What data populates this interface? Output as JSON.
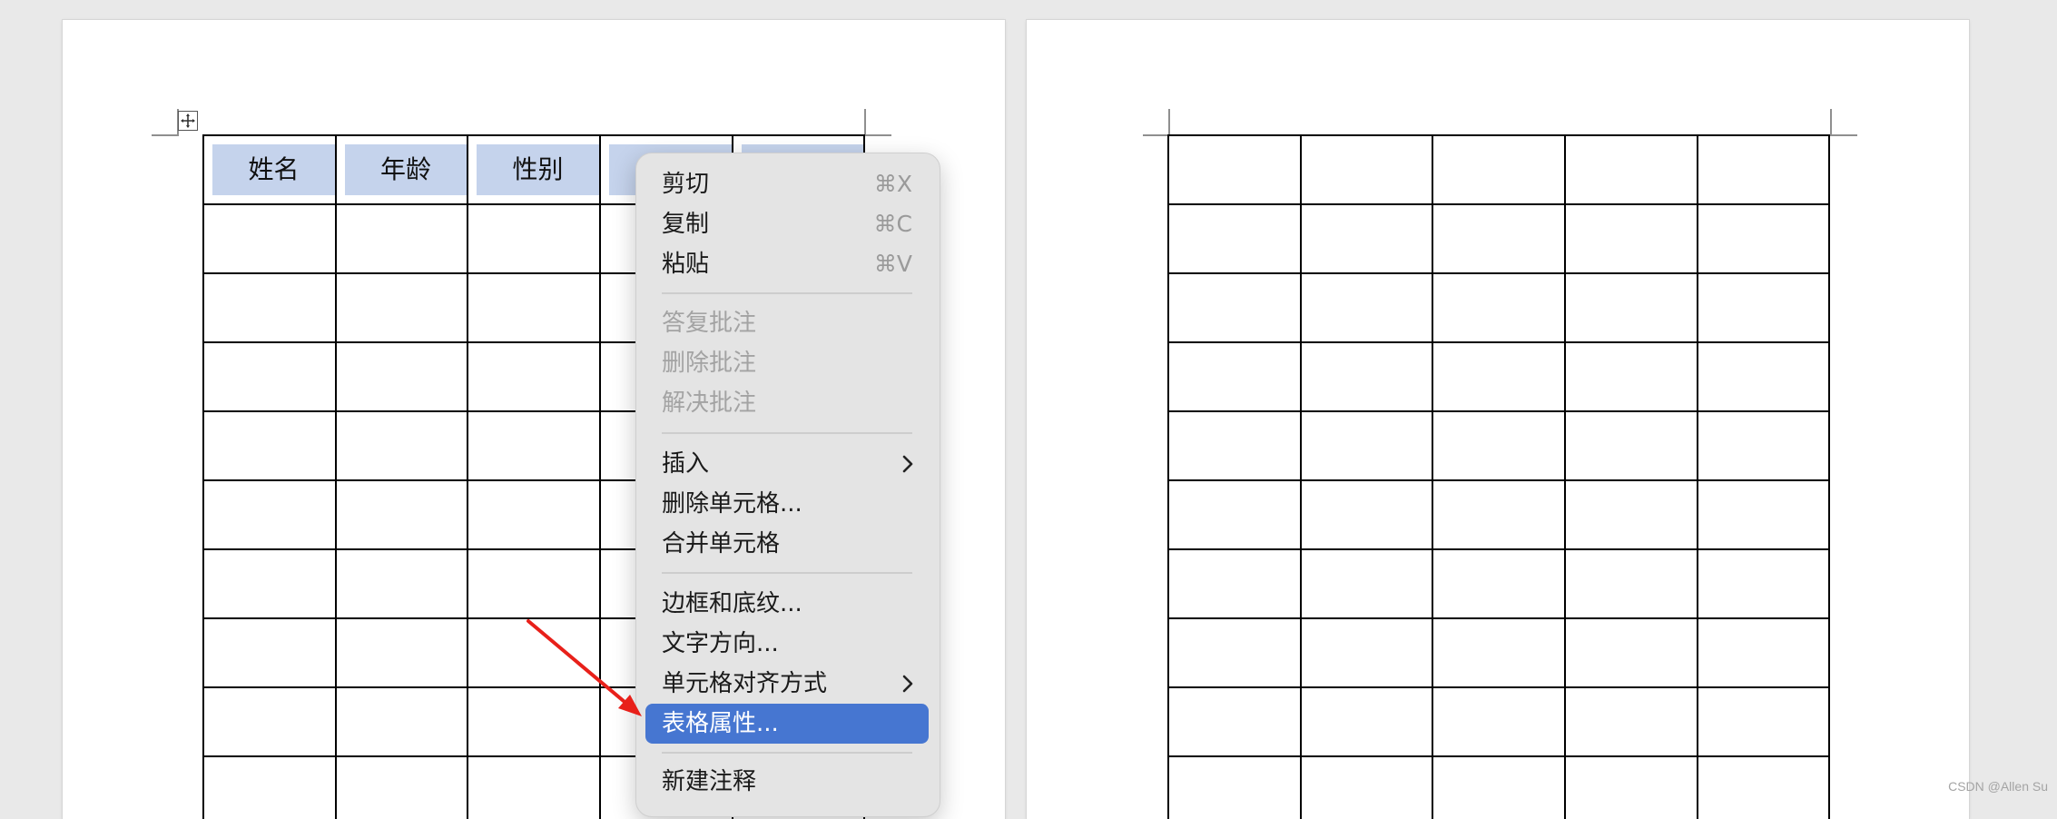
{
  "document": {
    "left_page": {
      "table": {
        "header": [
          "姓名",
          "年龄",
          "性别",
          "",
          ""
        ],
        "body_rows": 9,
        "columns": 5
      }
    },
    "right_page": {
      "table": {
        "rows": 10,
        "columns": 5
      }
    }
  },
  "context_menu": {
    "items": [
      {
        "label": "剪切",
        "shortcut": "⌘X",
        "enabled": true
      },
      {
        "label": "复制",
        "shortcut": "⌘C",
        "enabled": true
      },
      {
        "label": "粘贴",
        "shortcut": "⌘V",
        "enabled": true
      },
      {
        "label": "答复批注",
        "enabled": false
      },
      {
        "label": "删除批注",
        "enabled": false
      },
      {
        "label": "解决批注",
        "enabled": false
      },
      {
        "label": "插入",
        "submenu": true,
        "enabled": true
      },
      {
        "label": "删除单元格...",
        "enabled": true
      },
      {
        "label": "合并单元格",
        "enabled": true
      },
      {
        "label": "边框和底纹...",
        "enabled": true
      },
      {
        "label": "文字方向...",
        "enabled": true
      },
      {
        "label": "单元格对齐方式",
        "submenu": true,
        "enabled": true
      },
      {
        "label": "表格属性...",
        "enabled": true,
        "highlighted": true
      },
      {
        "label": "新建注释",
        "enabled": true
      }
    ]
  },
  "colors": {
    "header_fill": "#c5d3ec",
    "menu_highlight": "#4676d1",
    "annotation_arrow": "#e8201a"
  },
  "watermark": "CSDN @Allen Su"
}
